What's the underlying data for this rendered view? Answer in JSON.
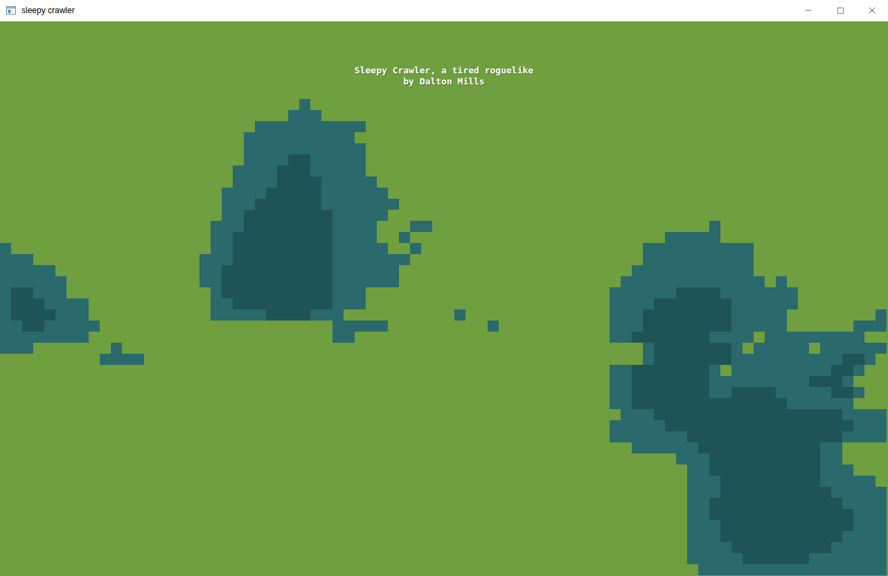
{
  "window": {
    "title": "sleepy crawler"
  },
  "title_screen": {
    "lines": [
      "Sleepy Crawler, a tired roguelike",
      "by Dalton Mills"
    ]
  },
  "map": {
    "tiles": [
      {
        "symbol": ".",
        "kind": "grass",
        "color": "#6f9f3f"
      },
      {
        "symbol": "w",
        "kind": "shallow-water",
        "color": "#2a6a6d"
      },
      {
        "symbol": "W",
        "kind": "deep-water",
        "color": "#1f5457"
      }
    ],
    "rows": [
      "................................................................................",
      "................................................................................",
      "................................................................................",
      "................................................................................",
      "................................................................................",
      "................................................................................",
      "................................................................................",
      "...........................w....................................................",
      "..........................www...................................................",
      ".......................wwwwwwwwww...............................................",
      "......................wwwwwwwwww................................................",
      "......................wwwwwwwwwww...............................................",
      "......................wwwwWWwwwww...............................................",
      ".....................wwwwWWWwwwww...............................................",
      ".....................wwwwWWWWwwwww..............................................",
      "....................wwwwWWWWWwwwwww.............................................",
      "....................wwwWWWWWWwwwwwww............................................",
      "....................wwWWWWWWWWwwwww.............................................",
      "...................wwwWWWWWWWWwwww...ww.........................w...............",
      "...................wwWWWWWWWWWwwww..w.......................wwwww...............",
      "w..................wwWWWWWWWWWwwwww..w....................wwwwwwwwww............",
      "www...............wwwWWWWWWWWWwwwwwww.....................wwwwwwwwww............",
      "wwwww.............wwWWWWWWWWWWwwwwww.....................wwwwwwwwwww............",
      "wwwwww............wwWWWWWWWWWWwwwwww....................wwwwwwwwwwwww.w.........",
      "wWWwww.............wWWWWWWWWWWwww......................wwwwwwWWWWwwwwwww........",
      "wWWWwwww...........wwWWWWWWWWWwww......................wwwwWWWWWWWwwwwww........",
      "wWWWWwww...........wwwwwWWWWwww..........w.............wwwWWWWWWWWwwwww........w",
      "wwWWwwwww.....................wwwww.........w..........wwwWWWWWWWWwwwww......www",
      "wwwwwwww......................ww.......................wwWWWWWWWwwww.wwwwwwwww",
      "www.......w...............................................wWWWWWWWw.wwwww.wwwwww",
      ".........wwww.............................................wWWWWWWWwwwwwwwwwwWWw",
      ".......................................................wwWWWWWWWw.wwwwwwwwwWWw",
      ".......................................................wwWWWWWWWwwwwwwwwwWWWw",
      ".......................................................wwWWWWWWWwwWWWWwwwwwWWw",
      ".......................................................wwWWWWWWWWWWWWWWwwwwww",
      "........................................................wwwWWWWWWWWWWWWWWWWWwwww",
      ".......................................................wwwwwWWWWWWWWWWWWWWWWWwww",
      ".......................................................wwwwwwwWWWWWWWWWWWWWWwwww",
      ".........................................................wwwwwwWWWWWWWWWWWww....",
      ".............................................................wwwWWWWWWWWWWww....",
      "..............................................................wwWWWWWWWWWWwww...",
      "..............................................................wwwWWWWWWWWWwwwww.",
      "..............................................................wwwWWWWWWWWWWwwwww",
      "..............................................................wwWWWWWWWWWWWWwwww",
      "..............................................................wwWWWWWWWWWWWWWwww",
      "..............................................................wwwWWWWWWWWWWWWwww",
      "..............................................................wwwWWWWWWWWWWWwwww",
      "..............................................................wwwwWWWWWWWWWwwwww",
      "..............................................................wwwwwWWWWWWwwwwwww",
      "...............................................................wwwwwwwwwwwwwwwww"
    ]
  }
}
